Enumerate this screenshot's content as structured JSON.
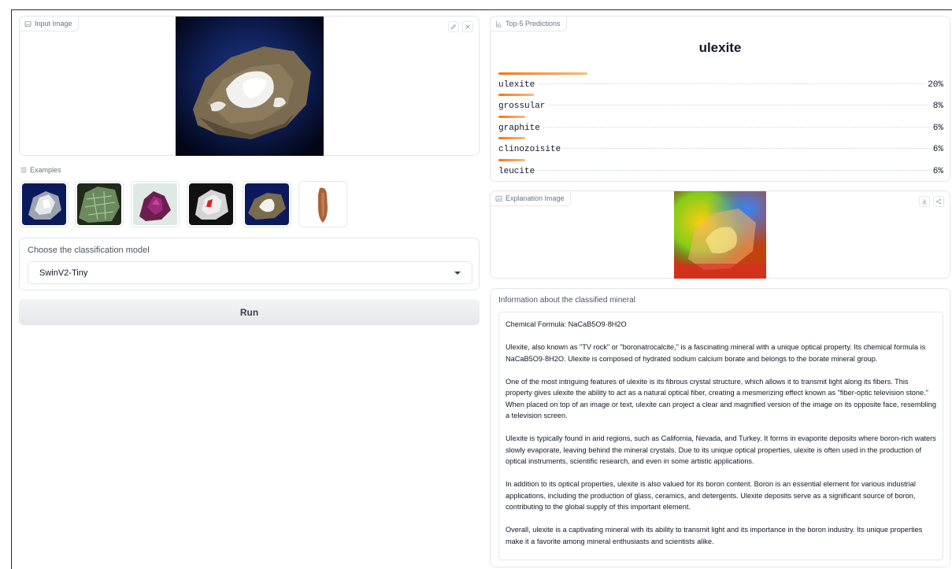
{
  "input": {
    "label": "Input Image"
  },
  "examples": {
    "label": "Examples",
    "count": 6
  },
  "model": {
    "label": "Choose the classification model",
    "selected": "SwinV2-Tiny"
  },
  "run": {
    "label": "Run"
  },
  "predictions": {
    "label": "Top-5 Predictions",
    "top": "ulexite",
    "items": [
      {
        "name": "ulexite",
        "pct": "20%",
        "value": 0.2
      },
      {
        "name": "grossular",
        "pct": "8%",
        "value": 0.08
      },
      {
        "name": "graphite",
        "pct": "6%",
        "value": 0.06
      },
      {
        "name": "clinozoisite",
        "pct": "6%",
        "value": 0.06
      },
      {
        "name": "leucite",
        "pct": "6%",
        "value": 0.06
      }
    ]
  },
  "explanation": {
    "label": "Explanation Image"
  },
  "info": {
    "label": "Information about the classified mineral",
    "formula": "Chemical Formula: NaCaB5O9·8H2O",
    "paragraphs": [
      "Ulexite, also known as \"TV rock\" or \"boronatrocalcite,\" is a fascinating mineral with a unique optical property. Its chemical formula is NaCaB5O9·8H2O. Ulexite is composed of hydrated sodium calcium borate and belongs to the borate mineral group.",
      "One of the most intriguing features of ulexite is its fibrous crystal structure, which allows it to transmit light along its fibers. This property gives ulexite the ability to act as a natural optical fiber, creating a mesmerizing effect known as \"fiber-optic television stone.\" When placed on top of an image or text, ulexite can project a clear and magnified version of the image on its opposite face, resembling a television screen.",
      "Ulexite is typically found in arid regions, such as California, Nevada, and Turkey. It forms in evaporite deposits where boron-rich waters slowly evaporate, leaving behind the mineral crystals. Due to its unique optical properties, ulexite is often used in the production of optical instruments, scientific research, and even in some artistic applications.",
      "In addition to its optical properties, ulexite is also valued for its boron content. Boron is an essential element for various industrial applications, including the production of glass, ceramics, and detergents. Ulexite deposits serve as a significant source of boron, contributing to the global supply of this important element.",
      "Overall, ulexite is a captivating mineral with its ability to transmit light and its importance in the boron industry. Its unique properties make it a favorite among mineral enthusiasts and scientists alike."
    ]
  }
}
